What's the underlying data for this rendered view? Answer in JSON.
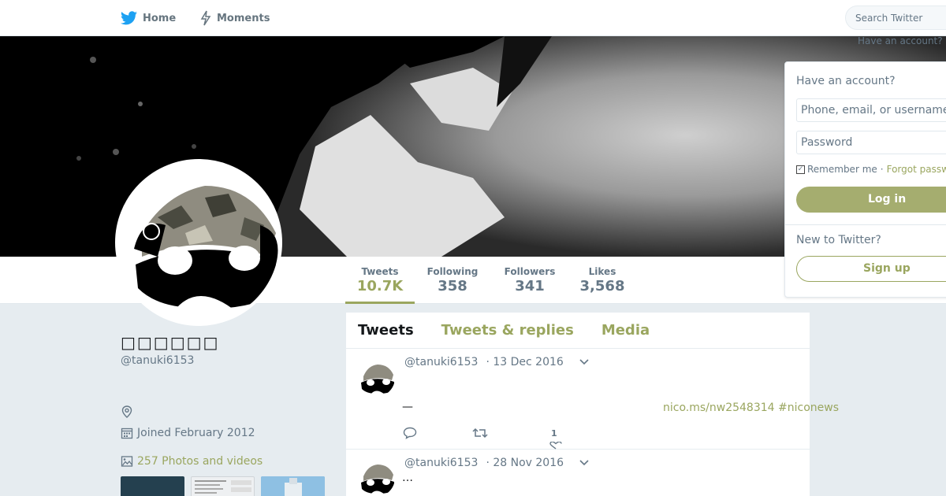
{
  "nav": {
    "home_label": "Home",
    "moments_label": "Moments",
    "search_placeholder": "Search Twitter",
    "have_account_link": "Have an account?"
  },
  "profile": {
    "name": "□□□□□□",
    "handle": "@tanuki6153",
    "joined": "Joined February 2012",
    "photos_label": "257 Photos and videos"
  },
  "stats": [
    {
      "label": "Tweets",
      "value": "10.7K"
    },
    {
      "label": "Following",
      "value": "358"
    },
    {
      "label": "Followers",
      "value": "341"
    },
    {
      "label": "Likes",
      "value": "3,568"
    }
  ],
  "timeline": {
    "tabs": [
      "Tweets",
      "Tweets & replies",
      "Media"
    ],
    "tweets": [
      {
        "handle": "@tanuki6153",
        "date": "· 13 Dec 2016",
        "text": "—",
        "link": "nico.ms/nw2548314 #niconews",
        "like_count": "1"
      },
      {
        "handle": "@tanuki6153",
        "date": "· 28 Nov 2016",
        "text": "…"
      }
    ]
  },
  "login": {
    "title": "Have an account?",
    "username_placeholder": "Phone, email, or username",
    "password_placeholder": "Password",
    "remember_label": "Remember me",
    "separator": "·",
    "forgot_label": "Forgot password?",
    "login_button": "Log in",
    "new_title": "New to Twitter?",
    "signup_button": "Sign up"
  },
  "colors": {
    "accent": "#9aa65f",
    "login_button": "#a5ad6f",
    "twitter_blue": "#1da1f2",
    "background": "#e6ecf0"
  },
  "icons": [
    "twitter-bird-icon",
    "lightning-icon",
    "location-pin-icon",
    "calendar-icon",
    "photo-icon",
    "reply-icon",
    "retweet-icon",
    "heart-icon",
    "chevron-down-icon"
  ]
}
